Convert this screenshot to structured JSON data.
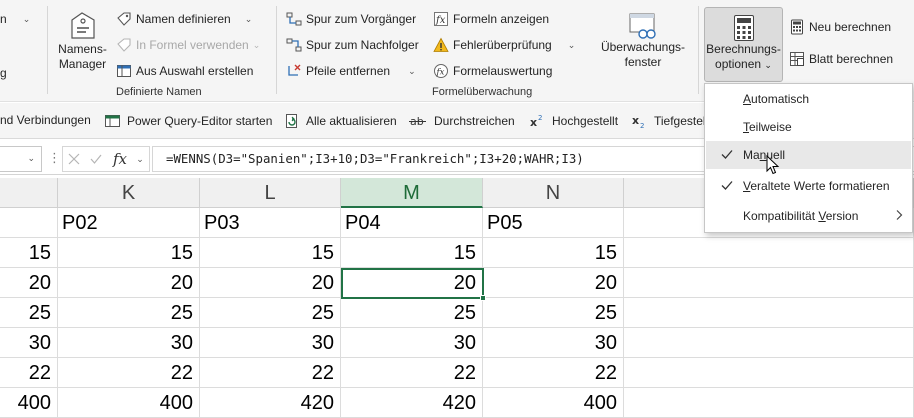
{
  "ribbon": {
    "cut_left_top": "n",
    "cut_left_mid": "g",
    "names_manager_line1": "Namens-",
    "names_manager_line2": "Manager",
    "define_name": "Namen definieren",
    "use_in_formula": "In Formel verwenden",
    "create_from_selection": "Aus Auswahl erstellen",
    "group_defined_names": "Definierte Namen",
    "trace_precedents": "Spur zum Vorgänger",
    "trace_dependents": "Spur zum Nachfolger",
    "remove_arrows": "Pfeile entfernen",
    "show_formulas": "Formeln anzeigen",
    "error_checking": "Fehlerüberprüfung",
    "evaluate_formula": "Formelauswertung",
    "group_formula_auditing": "Formelüberwachung",
    "watch_window_line1": "Überwachungs-",
    "watch_window_line2": "fenster",
    "calc_options_line1": "Berechnungs-",
    "calc_options_line2": "optionen",
    "calc_now": "Neu berechnen",
    "calc_sheet": "Blatt berechnen"
  },
  "qbar": {
    "connections": "nd Verbindungen",
    "power_query": "Power Query-Editor starten",
    "refresh_all": "Alle aktualisieren",
    "strikethrough": "Durchstreichen",
    "superscript": "Hochgestellt",
    "subscript": "Tiefgestellt"
  },
  "formula_bar": {
    "formula": "=WENNS(D3=\"Spanien\";I3+10;D3=\"Frankreich\";I3+20;WAHR;I3)",
    "fx": "fx"
  },
  "grid": {
    "columns": [
      {
        "letter": "",
        "selected": false
      },
      {
        "letter": "K",
        "selected": false
      },
      {
        "letter": "L",
        "selected": false
      },
      {
        "letter": "M",
        "selected": true
      },
      {
        "letter": "N",
        "selected": false
      },
      {
        "letter": "O",
        "selected": false
      }
    ],
    "header_row": [
      "",
      "P02",
      "P03",
      "P04",
      "P05",
      ""
    ],
    "rows": [
      [
        "15",
        "15",
        "15",
        "15",
        "15",
        ""
      ],
      [
        "20",
        "20",
        "20",
        "20",
        "20",
        ""
      ],
      [
        "25",
        "25",
        "25",
        "25",
        "25",
        ""
      ],
      [
        "30",
        "30",
        "30",
        "30",
        "30",
        ""
      ],
      [
        "22",
        "22",
        "22",
        "22",
        "22",
        ""
      ],
      [
        "400",
        "400",
        "420",
        "420",
        "400",
        ""
      ]
    ]
  },
  "menu": {
    "items": [
      {
        "pre": "",
        "ul": "A",
        "post": "utomatisch",
        "checked": false
      },
      {
        "pre": "",
        "ul": "T",
        "post": "eilweise",
        "checked": false
      },
      {
        "pre": "Ma",
        "ul": "n",
        "post": "uell",
        "checked": true
      },
      {
        "pre": "",
        "ul": "V",
        "post": "eraltete Werte formatieren",
        "checked": true
      },
      {
        "pre": "Kompatibilität ",
        "ul": "V",
        "post": "ersion",
        "checked": false
      }
    ]
  },
  "colors": {
    "accent": "#217346",
    "ribbon_bg": "#f5f5f5",
    "selected_header_bg": "#d3e7d9"
  }
}
